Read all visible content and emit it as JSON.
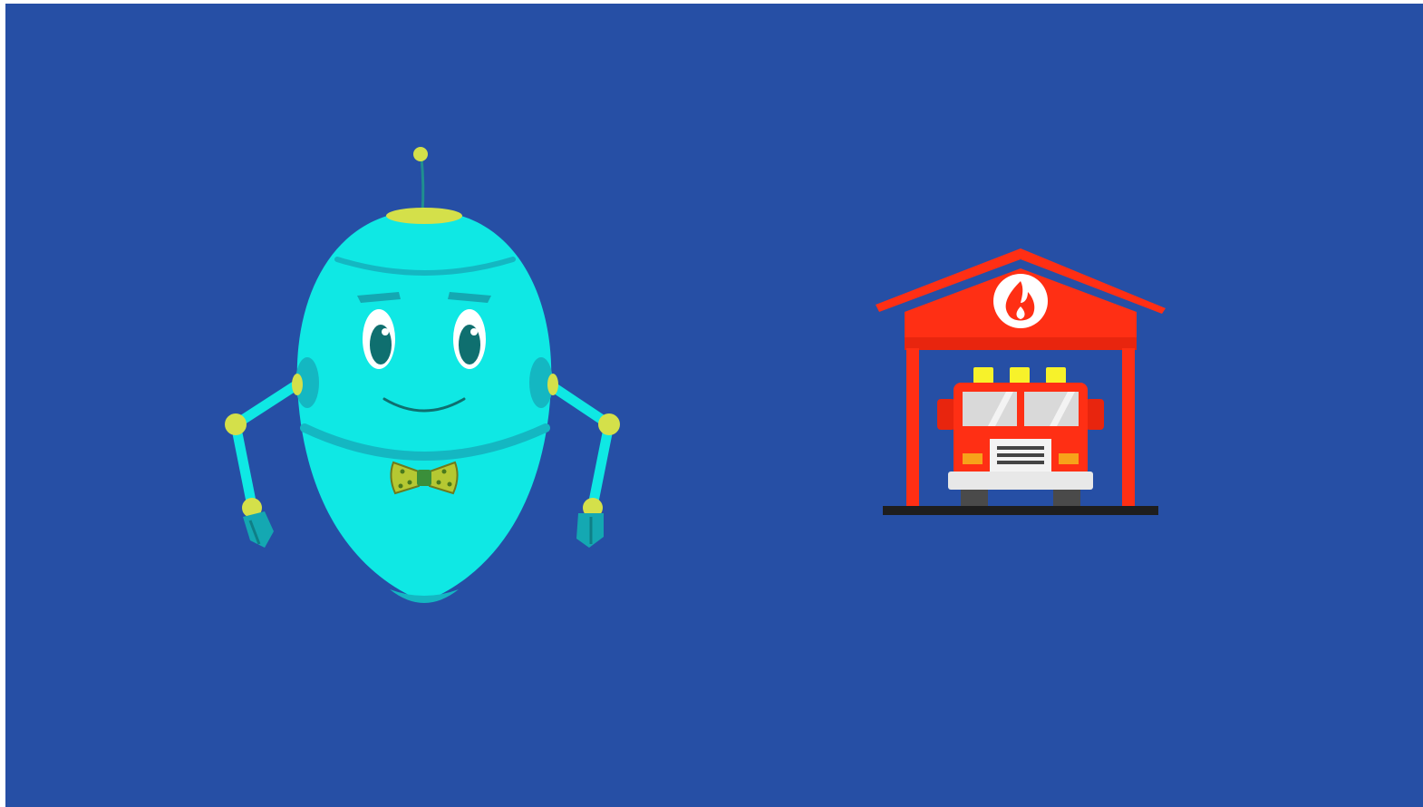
{
  "scene": {
    "background_color": "#264fa5",
    "characters": [
      {
        "kind": "robot",
        "icon": "robot-icon",
        "body_color": "#0fe8e4",
        "shade_color": "#14b7c2",
        "accent_color": "#d4e04a",
        "bowtie_color": "#b5c832",
        "eye_color": "#0f6f6f"
      }
    ],
    "objects": [
      {
        "kind": "fire-station",
        "icon": "fire-station-icon",
        "roof_color": "#ff2f14",
        "emblem_icon": "flame-icon",
        "vehicle": {
          "kind": "fire-truck",
          "icon": "fire-truck-icon",
          "body_color": "#ff2f14",
          "light_color": "#f7f22a",
          "window_color": "#d9d9d9",
          "bumper_color": "#e8e8e8"
        },
        "ground_color": "#1e1e1e"
      }
    ]
  }
}
